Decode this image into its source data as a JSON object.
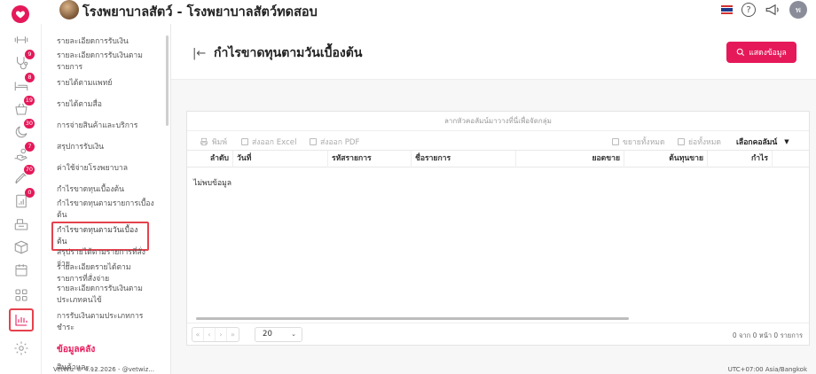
{
  "header": {
    "hospital_title": "โรงพยาบาลสัตว์ - โรงพยาบาลสัตว์ทดสอบ",
    "user_initial": "พ"
  },
  "rail": {
    "badges": [
      "9",
      "8",
      "19",
      "30",
      "7",
      "70",
      "0"
    ]
  },
  "submenu": {
    "items": [
      "รายละเอียดการรับเงิน",
      "รายละเอียดการรับเงินตามรายการ",
      "รายได้ตามแพทย์",
      "รายได้ตามสื่อ",
      "การจ่ายสินค้าและบริการ",
      "สรุปการรับเงิน",
      "ค่าใช้จ่ายโรงพยาบาล",
      "กำไรขาดทุนเบื้องต้น",
      "กำไรขาดทุนตามรายการเบื้องต้น",
      "กำไรขาดทุนตามวันเบื้องต้น",
      "สรุปรายได้ตามรายการที่สั่งจ่าย",
      "รายละเอียดรายได้ตามรายการที่สั่งจ่าย",
      "รายละเอียดการรับเงินตามประเภทคนไข้",
      "การรับเงินตามประเภทการชำระ"
    ],
    "section_label": "ข้อมูลคลัง",
    "next_item": "สินค้าและ..."
  },
  "page": {
    "title": "กำไรขาดทุนตามวันเบื้องต้น",
    "show_button": "แสดงข้อมูล"
  },
  "grid": {
    "group_hint": "ลากหัวคอลัมน์มาวางที่นี่เพื่อจัดกลุ่ม",
    "toolbar": {
      "print": "พิมพ์",
      "export_excel": "ส่งออก Excel",
      "export_pdf": "ส่งออก PDF",
      "expand_all": "ขยายทั้งหมด",
      "collapse_all": "ย่อทั้งหมด",
      "choose_columns": "เลือกคอลัมน์"
    },
    "columns": [
      "ลำดับ",
      "วันที่",
      "รหัสรายการ",
      "ชื่อรายการ",
      "ยอดขาย",
      "ต้นทุนขาย",
      "กำไร"
    ],
    "empty_text": "ไม่พบข้อมูล",
    "pager": {
      "page_size": "20",
      "info": "0 จาก 0 หน้า 0 รายการ"
    }
  },
  "footer": {
    "left": "VetWiz © 4.12.2026 - @vetwiz...",
    "right": "UTC+07:00 Asia/Bangkok"
  },
  "colors": {
    "accent": "#e5195a",
    "highlight_box": "#e5424d"
  }
}
